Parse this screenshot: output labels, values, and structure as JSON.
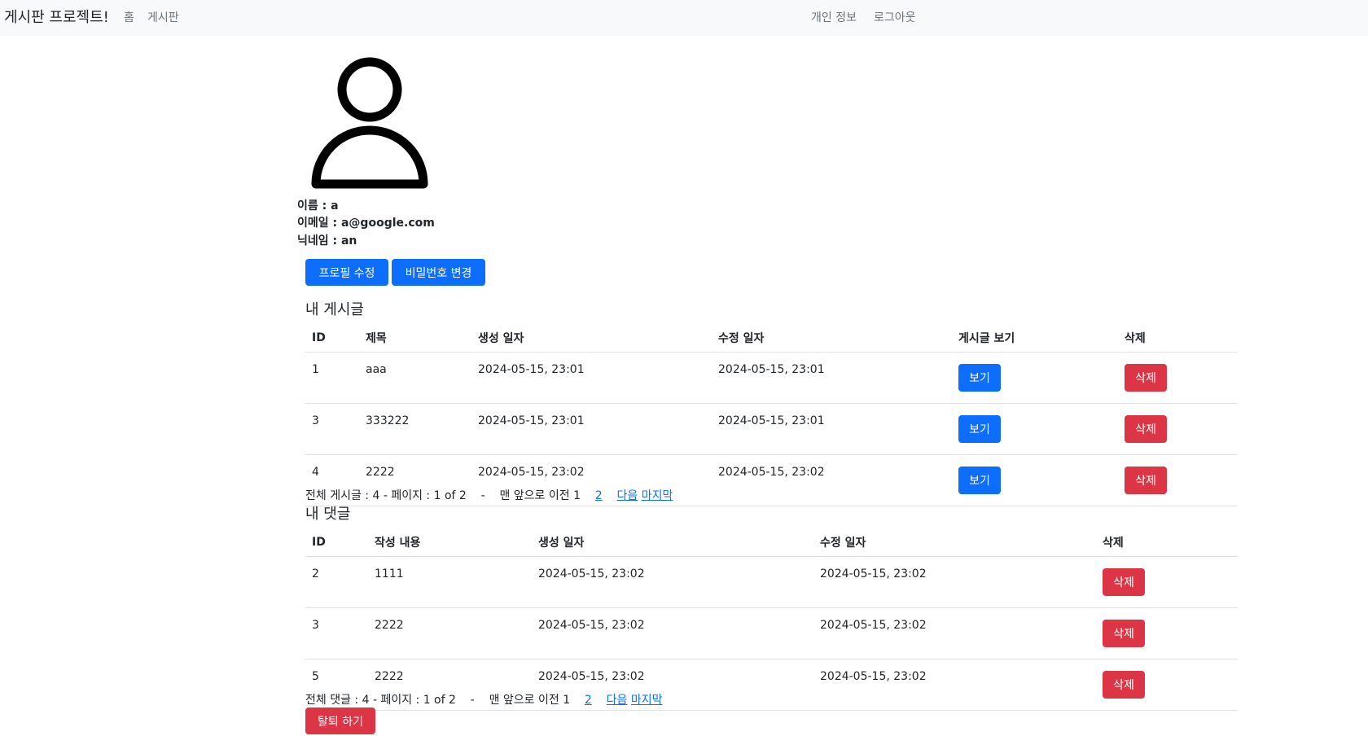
{
  "navbar": {
    "brand": "게시판 프로젝트!",
    "home": "홈",
    "board": "게시판",
    "profile": "개인 정보",
    "logout": "로그아웃"
  },
  "profile": {
    "avatar_icon": "person-icon",
    "name_line": "이름 : a",
    "email_line": "이메일 : a@google.com",
    "nickname_line": "닉네임 : an",
    "edit_profile_label": "프로필 수정",
    "change_password_label": "비밀번호 변경"
  },
  "posts": {
    "title": "내 게시글",
    "headers": [
      "ID",
      "제목",
      "생성 일자",
      "수정 일자",
      "게시글 보기",
      "삭제"
    ],
    "rows": [
      {
        "id": "1",
        "title": "aaa",
        "created": "2024-05-15, 23:01",
        "modified": "2024-05-15, 23:01",
        "view": "보기",
        "delete": "삭제"
      },
      {
        "id": "3",
        "title": "333222",
        "created": "2024-05-15, 23:01",
        "modified": "2024-05-15, 23:01",
        "view": "보기",
        "delete": "삭제"
      },
      {
        "id": "4",
        "title": "2222",
        "created": "2024-05-15, 23:02",
        "modified": "2024-05-15, 23:02",
        "view": "보기",
        "delete": "삭제"
      }
    ],
    "pager": {
      "summary": "전체 게시글 : 4 - 페이지 : 1 of 2    -    맨 앞으로 이전 1    ",
      "page2": "2",
      "next": "다음",
      "last": "마지막"
    }
  },
  "comments": {
    "title": "내 댓글",
    "headers": [
      "ID",
      "작성 내용",
      "생성 일자",
      "수정 일자",
      "삭제"
    ],
    "rows": [
      {
        "id": "2",
        "content": "1111",
        "created": "2024-05-15, 23:02",
        "modified": "2024-05-15, 23:02",
        "delete": "삭제"
      },
      {
        "id": "3",
        "content": "2222",
        "created": "2024-05-15, 23:02",
        "modified": "2024-05-15, 23:02",
        "delete": "삭제"
      },
      {
        "id": "5",
        "content": "2222",
        "created": "2024-05-15, 23:02",
        "modified": "2024-05-15, 23:02",
        "delete": "삭제"
      }
    ],
    "pager": {
      "summary": "전체 댓글 : 4 - 페이지 : 1 of 2    -    맨 앞으로 이전 1    ",
      "page2": "2",
      "next": "다음",
      "last": "마지막"
    }
  },
  "withdraw_label": "탈퇴 하기",
  "colors": {
    "primary": "#0d6efd",
    "danger": "#dc3545",
    "navbar_bg": "#f8f9fa"
  }
}
